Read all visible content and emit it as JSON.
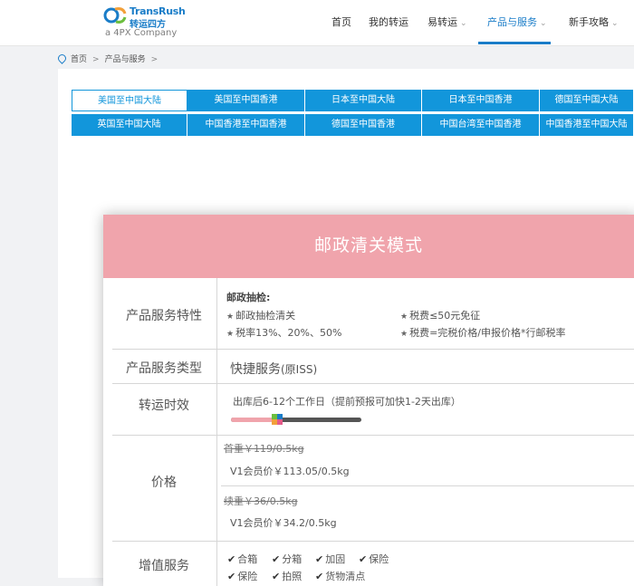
{
  "header": {
    "logo": {
      "brand": "TransRush",
      "cn": "转运四方",
      "sub": "a 4PX Company"
    },
    "nav": [
      {
        "label": "首页",
        "dropdown": false
      },
      {
        "label": "我的转运",
        "dropdown": false
      },
      {
        "label": "易转运",
        "dropdown": true
      },
      {
        "label": "产品与服务",
        "dropdown": true,
        "active": true
      },
      {
        "label": "新手攻略",
        "dropdown": true
      }
    ]
  },
  "breadcrumb": [
    "首页",
    "产品与服务"
  ],
  "tabs": {
    "row1": [
      "美国至中国大陆",
      "美国至中国香港",
      "日本至中国大陆",
      "日本至中国香港",
      "德国至中国大陆"
    ],
    "row2": [
      "英国至中国大陆",
      "中国香港至中国香港",
      "德国至中国香港",
      "中国台湾至中国香港",
      "中国香港至中国大陆"
    ]
  },
  "card": {
    "title": "邮政清关模式",
    "features": {
      "label": "产品服务特性",
      "heading": "邮政抽检:",
      "items": [
        "邮政抽检清关",
        "税费≤50元免征",
        "税率13%、20%、50%",
        "税费=完税价格/申报价格*行邮税率"
      ]
    },
    "service_type": {
      "label": "产品服务类型",
      "value": "快捷服务",
      "note": "(原ISS)"
    },
    "timing": {
      "label": "转运时效",
      "text": "出库后6-12个工作日（提前预报可加快1-2天出库）",
      "level": 0.33
    },
    "price": {
      "label": "价格",
      "first_weight": "首重￥119/0.5kg",
      "first_member": "V1会员价￥113.05/0.5kg",
      "extra_weight": "续重￥36/0.5kg",
      "extra_member": "V1会员价￥34.2/0.5kg"
    },
    "value_added": {
      "label": "增值服务",
      "row1": [
        "合箱",
        "分箱",
        "加固",
        "保险"
      ],
      "row2": [
        "保险",
        "拍照",
        "货物清点"
      ]
    }
  },
  "colors": {
    "brand": "#1a7dc8",
    "tab": "#1296db",
    "card_header": "#f0a4ac"
  }
}
